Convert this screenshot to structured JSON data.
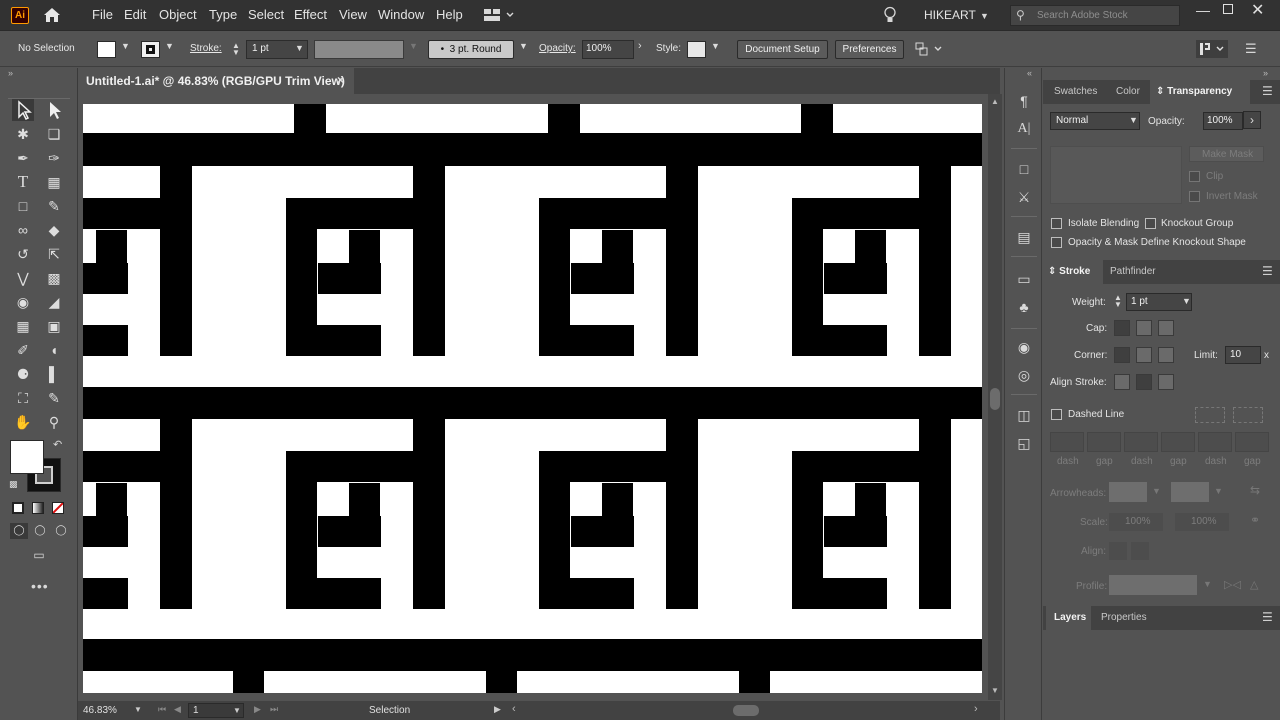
{
  "app": {
    "logo": "Ai",
    "menu": [
      "File",
      "Edit",
      "Object",
      "Type",
      "Select",
      "Effect",
      "View",
      "Window",
      "Help"
    ],
    "workspace": "HIKEART",
    "search_placeholder": "Search Adobe Stock",
    "accent": "#ff9a00"
  },
  "control_bar": {
    "selection_state": "No Selection",
    "stroke_label": "Stroke:",
    "stroke_value": "1 pt",
    "brush": "3 pt. Round",
    "opacity_label": "Opacity:",
    "opacity_value": "100%",
    "style_label": "Style:",
    "document_setup": "Document Setup",
    "preferences": "Preferences"
  },
  "document": {
    "tab_title": "Untitled-1.ai* @ 46.83% (RGB/GPU Trim View)",
    "close": "×"
  },
  "status_bar": {
    "zoom": "46.83%",
    "artboard": "1",
    "tool": "Selection"
  },
  "transparency_panel": {
    "tabs": [
      "Swatches",
      "Color",
      "Transparency"
    ],
    "active_tab": "Transparency",
    "blend_mode": "Normal",
    "opacity_label": "Opacity:",
    "opacity_value": "100%",
    "make_mask": "Make Mask",
    "clip": "Clip",
    "invert_mask": "Invert Mask",
    "isolate_blending": "Isolate Blending",
    "knockout_group": "Knockout Group",
    "opacity_mask_knockout": "Opacity & Mask Define Knockout Shape"
  },
  "stroke_panel": {
    "tabs": [
      "Stroke",
      "Pathfinder"
    ],
    "weight_label": "Weight:",
    "weight_value": "1 pt",
    "cap_label": "Cap:",
    "corner_label": "Corner:",
    "limit_label": "Limit:",
    "limit_value": "10",
    "limit_unit": "x",
    "align_stroke_label": "Align Stroke:",
    "dashed_line": "Dashed Line",
    "dash_labels": [
      "dash",
      "gap",
      "dash",
      "gap",
      "dash",
      "gap"
    ],
    "arrowheads_label": "Arrowheads:",
    "scale_label": "Scale:",
    "scale_values": [
      "100%",
      "100%"
    ],
    "align_label": "Align:",
    "profile_label": "Profile:"
  },
  "layers_panel": {
    "tabs": [
      "Layers",
      "Properties"
    ]
  },
  "icons": {
    "home": "home-icon",
    "bulb": "lightbulb-icon",
    "search": "search-icon"
  }
}
